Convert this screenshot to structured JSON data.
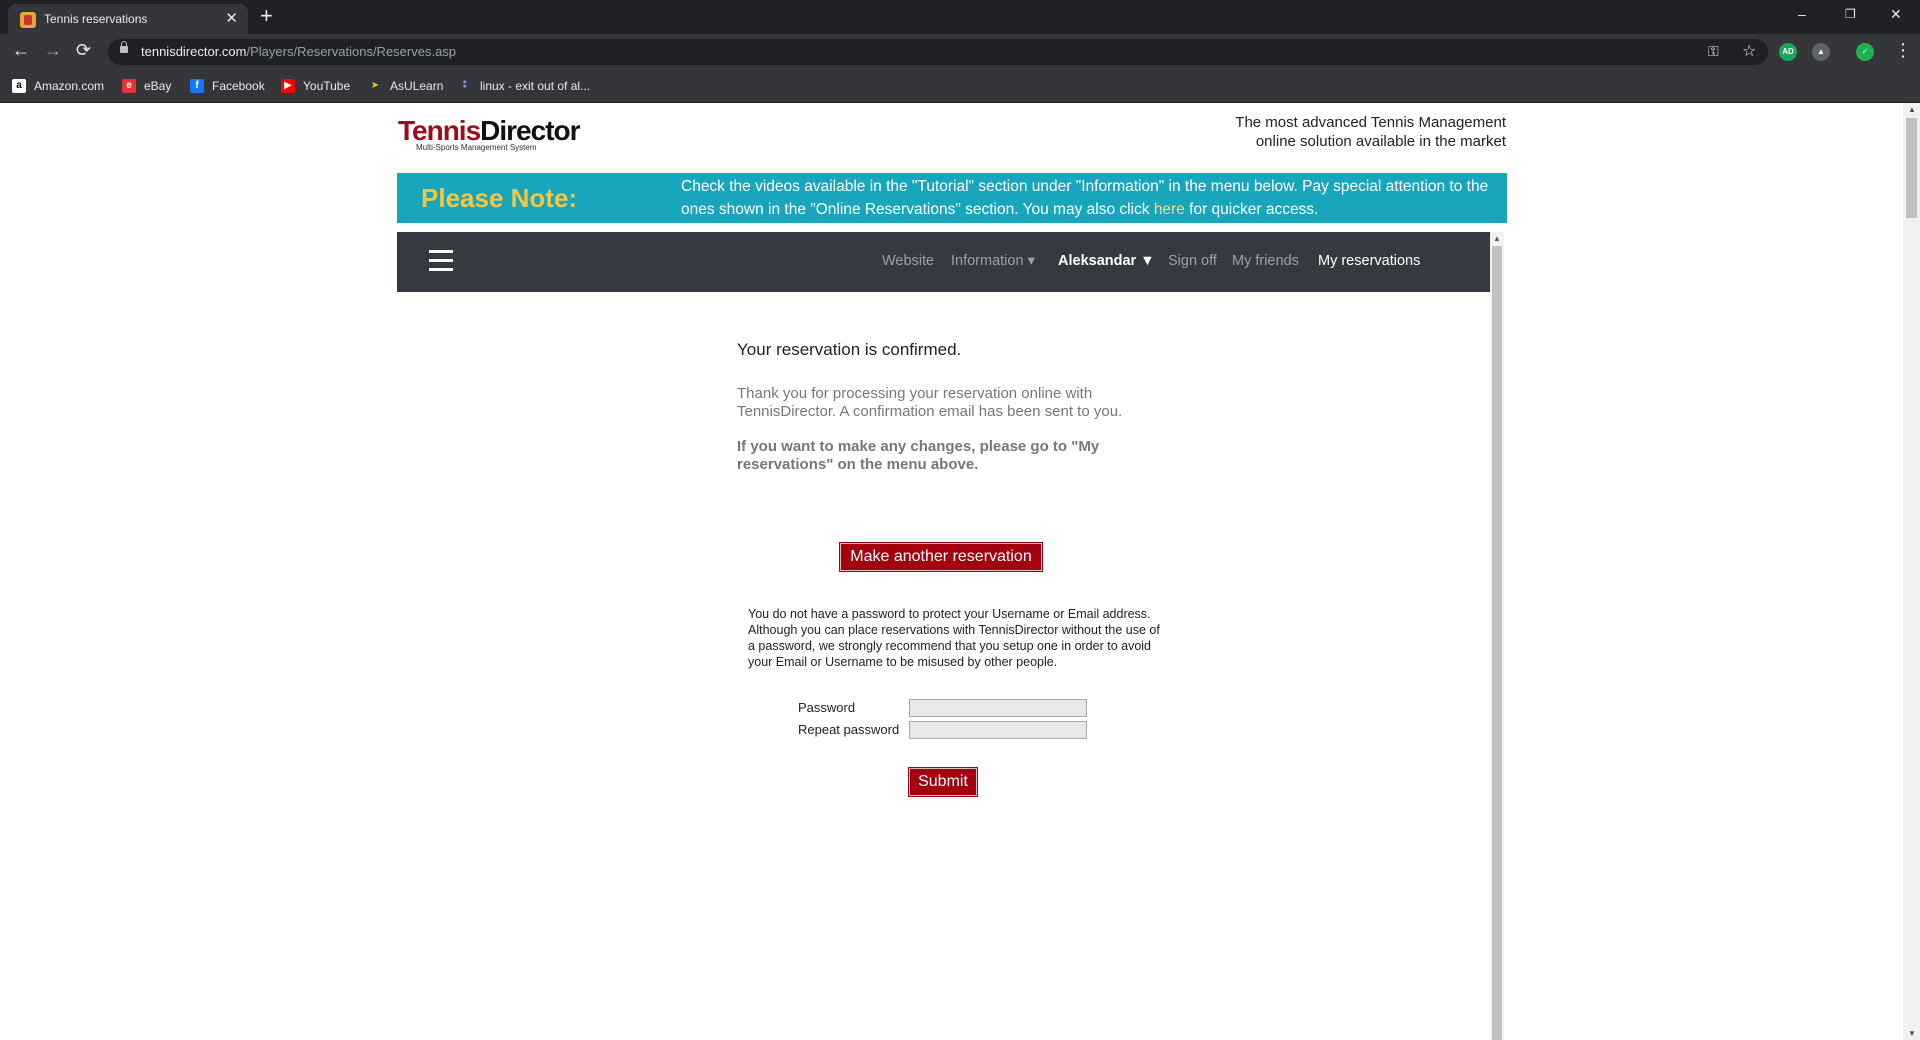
{
  "browser": {
    "tab_title": "Tennis reservations",
    "tab_close": "✕",
    "new_tab": "+",
    "window": {
      "minimize": "–",
      "restore": "❐",
      "close": "✕"
    },
    "url_host": "tennisdirector.com",
    "url_path": "/Players/Reservations/Reserves.asp",
    "back": "←",
    "forward": "→",
    "reload": "⟳",
    "key_icon": "⚿",
    "star_icon": "☆",
    "menu_icon": "⋮",
    "extensions": [
      {
        "name": "adguard-icon",
        "text": "AD",
        "color": "#1aa85a"
      },
      {
        "name": "drive-icon",
        "text": "▲",
        "color": "#5f6368"
      },
      {
        "name": "shield-icon",
        "text": "✓",
        "color": "#22b14c"
      }
    ],
    "bookmarks": [
      {
        "label": "Amazon.com",
        "icon": "a",
        "color": "#ffffff",
        "fg": "#000000"
      },
      {
        "label": "eBay",
        "icon": "e",
        "color": "#e53238",
        "fg": "#ffffff"
      },
      {
        "label": "Facebook",
        "icon": "f",
        "color": "#1877f2",
        "fg": "#ffffff"
      },
      {
        "label": "YouTube",
        "icon": "▶",
        "color": "#ff0000",
        "fg": "#ffffff"
      },
      {
        "label": "AsULearn",
        "icon": "➤",
        "color": "#35363a",
        "fg": "#f5c518"
      },
      {
        "label": "linux - exit out of al...",
        "icon": "⁑",
        "color": "#35363a",
        "fg": "#8ab4f8"
      }
    ]
  },
  "header": {
    "logo_red": "Tennis",
    "logo_dark": "Director",
    "logo_sub": "Multi-Sports Management System",
    "tagline_line1": "The most advanced Tennis Management",
    "tagline_line2": "online solution available in the market"
  },
  "notice": {
    "title": "Please Note:",
    "text_before": "Check the videos available in the \"Tutorial\" section under \"Information\" in the menu below. Pay special attention to the ones shown in the \"Online Reservations\" section. You may also click ",
    "link": "here",
    "text_after": " for quicker access."
  },
  "nav": {
    "website": "Website",
    "information": "Information ▾",
    "user": "Aleksandar ▼",
    "sign_off": "Sign off",
    "friends": "My friends",
    "reservations": "My reservations"
  },
  "main": {
    "confirm_title": "Your reservation is confirmed.",
    "thanks": "Thank you for processing your reservation online with TennisDirector. A confirmation email has been sent to you.",
    "changes": "If you want to make any changes, please go to \"My reservations\" on the menu above.",
    "another_button": "Make another reservation",
    "pw_note": "You do not have a password to protect your Username or Email address. Although you can place reservations with TennisDirector without the use of a password, we strongly recommend that you setup one in order to avoid your Email or Username to be misused by other people.",
    "password_label": "Password",
    "repeat_label": "Repeat password",
    "password_value": "",
    "repeat_value": "",
    "submit": "Submit"
  }
}
